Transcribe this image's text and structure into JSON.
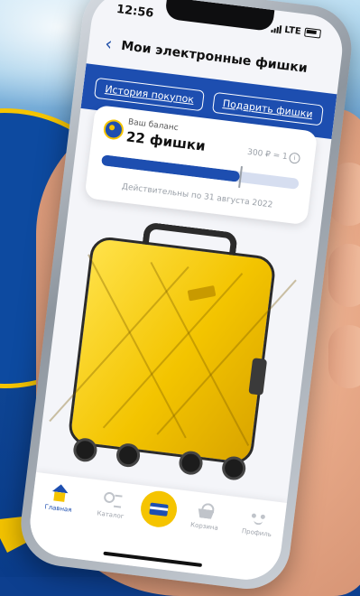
{
  "colors": {
    "brand_blue": "#1d4eb0",
    "brand_yellow": "#f5c400",
    "background_blue": "#0d3f8f"
  },
  "status_bar": {
    "time": "12:56",
    "network": "LTE"
  },
  "header": {
    "title": "Мои электронные фишки",
    "back_icon": "chevron-left-icon"
  },
  "actions": {
    "history_label": "История покупок",
    "gift_label": "Подарить фишки"
  },
  "balance": {
    "label": "Ваш баланс",
    "value": "22 фишки",
    "rate": "300 ₽ = 1",
    "progress_fraction": 0.7,
    "valid_until": "Действительны по 31 августа 2022"
  },
  "tabs": [
    {
      "label": "Главная",
      "icon": "home-icon",
      "active": true
    },
    {
      "label": "Каталог",
      "icon": "catalog-icon",
      "active": false
    },
    {
      "label": "",
      "icon": "card-icon",
      "active": false
    },
    {
      "label": "Корзина",
      "icon": "basket-icon",
      "active": false
    },
    {
      "label": "Профиль",
      "icon": "profile-icon",
      "active": false
    }
  ]
}
